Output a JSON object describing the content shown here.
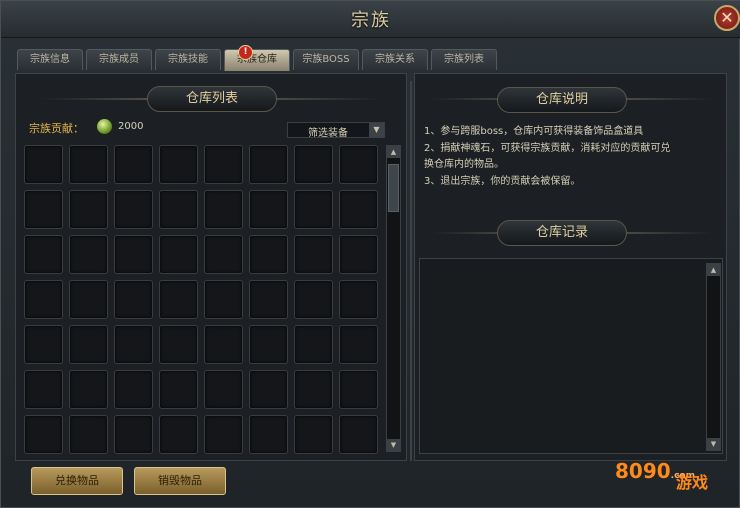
{
  "window": {
    "title": "宗族",
    "close_glyph": "✕"
  },
  "tabs": [
    {
      "label": "宗族信息"
    },
    {
      "label": "宗族成员"
    },
    {
      "label": "宗族技能"
    },
    {
      "label": "宗族仓库"
    },
    {
      "label": "宗族BOSS"
    },
    {
      "label": "宗族关系"
    },
    {
      "label": "宗族列表"
    }
  ],
  "active_tab": "宗族仓库",
  "skill_tab_badge": "!",
  "warehouse": {
    "title": "仓库列表",
    "contribution_label": "宗族贡献：",
    "contribution_value": "2000",
    "filter_label": "筛选装备",
    "grid": {
      "columns": 8,
      "rows": 7
    }
  },
  "description": {
    "title": "仓库说明",
    "lines": [
      "1、参与跨服boss，仓库内可获得装备饰品盒道具",
      "2、捐献神魂石，可获得宗族贡献，消耗对应的贡献可兑",
      "换仓库内的物品。",
      "3、退出宗族，你的贡献会被保留。"
    ]
  },
  "records": {
    "title": "仓库记录"
  },
  "buttons": {
    "exchange": "兑换物品",
    "destroy": "销毁物品"
  },
  "watermark": {
    "logo_text": "8090",
    "domain": ".com",
    "suffix": "游戏"
  },
  "colors": {
    "accent_gold": "#e3b64a",
    "button_gold": "#b79a5c",
    "close_red": "#b43a2b"
  }
}
